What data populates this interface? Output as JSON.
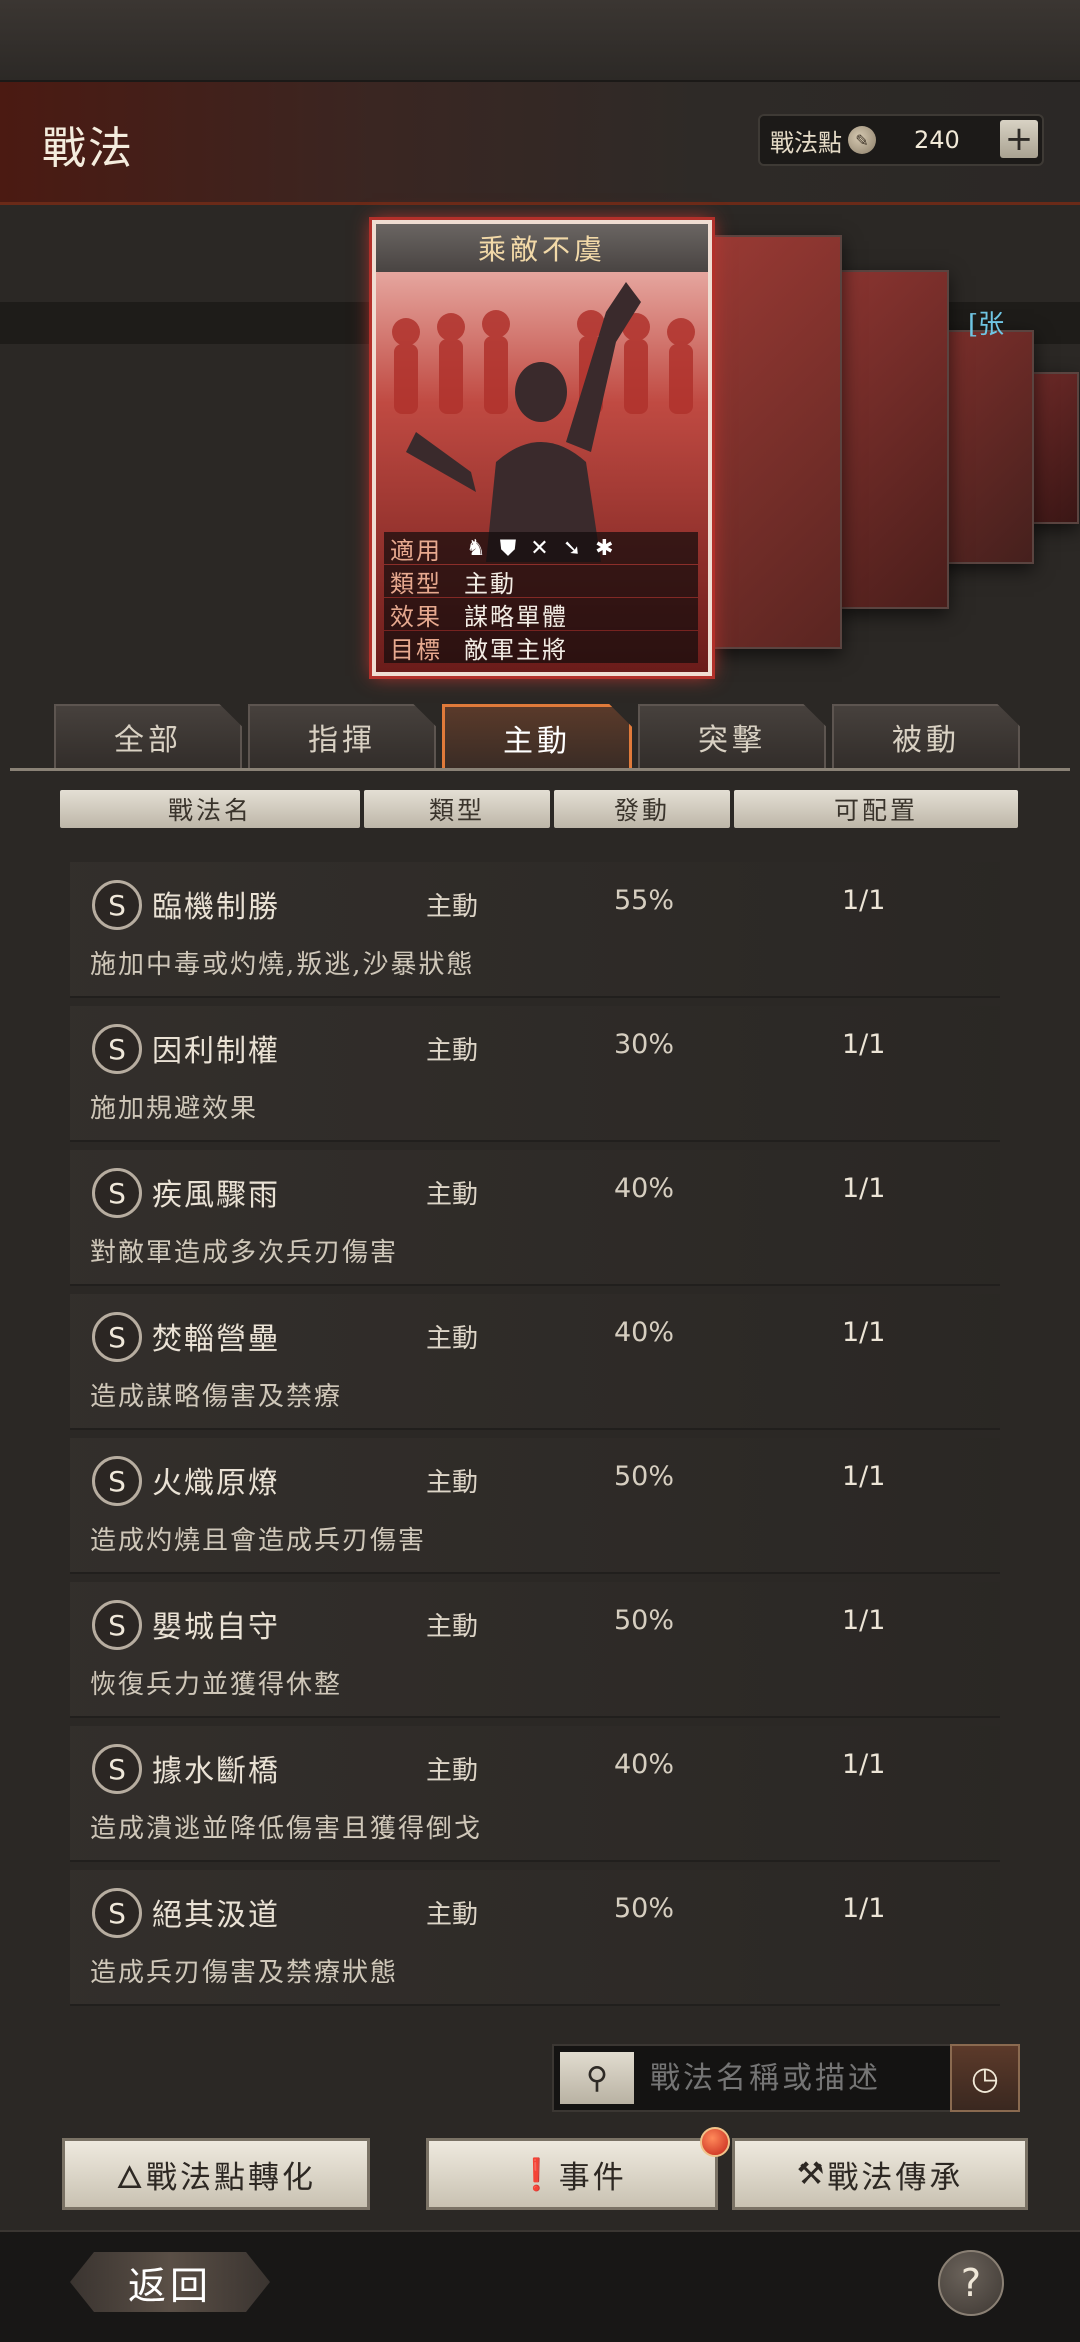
{
  "header": {
    "title": "戰法",
    "points_label": "戰法點",
    "points_value": "240",
    "plus": "+"
  },
  "featured_card": {
    "title": "乘敵不虞",
    "side_name": "[张",
    "info": [
      {
        "key": "適用",
        "value": ""
      },
      {
        "key": "類型",
        "value": "主動"
      },
      {
        "key": "效果",
        "value": "謀略單體"
      },
      {
        "key": "目標",
        "value": "敵軍主將"
      }
    ],
    "troop_icons": [
      "cavalry-icon",
      "shield-icon",
      "bow-icon",
      "spear-icon",
      "wheel-icon"
    ]
  },
  "tabs": [
    {
      "label": "全部",
      "active": false
    },
    {
      "label": "指揮",
      "active": false
    },
    {
      "label": "主動",
      "active": true
    },
    {
      "label": "突擊",
      "active": false
    },
    {
      "label": "被動",
      "active": false
    }
  ],
  "columns": [
    "戰法名",
    "類型",
    "發動",
    "可配置"
  ],
  "skills": [
    {
      "rank": "S",
      "name": "臨機制勝",
      "type": "主動",
      "rate": "55%",
      "capacity": "1/1",
      "desc": "施加中毒或灼燒,叛逃,沙暴狀態"
    },
    {
      "rank": "S",
      "name": "因利制權",
      "type": "主動",
      "rate": "30%",
      "capacity": "1/1",
      "desc": "施加規避效果"
    },
    {
      "rank": "S",
      "name": "疾風驟雨",
      "type": "主動",
      "rate": "40%",
      "capacity": "1/1",
      "desc": "對敵軍造成多次兵刃傷害"
    },
    {
      "rank": "S",
      "name": "焚輜營壘",
      "type": "主動",
      "rate": "40%",
      "capacity": "1/1",
      "desc": "造成謀略傷害及禁療"
    },
    {
      "rank": "S",
      "name": "火熾原燎",
      "type": "主動",
      "rate": "50%",
      "capacity": "1/1",
      "desc": "造成灼燒且會造成兵刃傷害"
    },
    {
      "rank": "S",
      "name": "嬰城自守",
      "type": "主動",
      "rate": "50%",
      "capacity": "1/1",
      "desc": "恢復兵力並獲得休整"
    },
    {
      "rank": "S",
      "name": "據水斷橋",
      "type": "主動",
      "rate": "40%",
      "capacity": "1/1",
      "desc": "造成潰逃並降低傷害且獲得倒戈"
    },
    {
      "rank": "S",
      "name": "絕其汲道",
      "type": "主動",
      "rate": "50%",
      "capacity": "1/1",
      "desc": "造成兵刃傷害及禁療狀態"
    }
  ],
  "search": {
    "placeholder": "戰法名稱或描述"
  },
  "buttons": {
    "convert": "戰法點轉化",
    "events": "事件",
    "inherit": "戰法傳承"
  },
  "footer": {
    "back": "返回",
    "help": "?"
  },
  "colors": {
    "accent": "#e07a3a",
    "card_glow": "#c2362f",
    "background": "#2b2825"
  }
}
